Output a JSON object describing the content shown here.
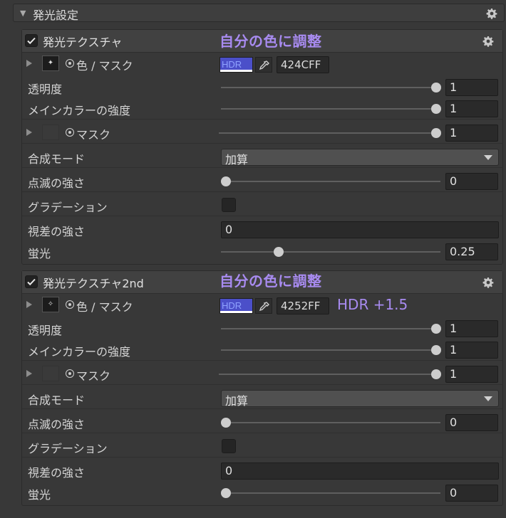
{
  "header": {
    "title": "発光設定"
  },
  "sections": [
    {
      "title": "発光テクスチャ",
      "note": "自分の色に調整",
      "color_label": "色 / マスク",
      "hdr_label": "HDR",
      "hex": "424CFF",
      "hdr_note": "",
      "opacity_label": "透明度",
      "opacity": "1",
      "main_strength_label": "メインカラーの強度",
      "main_strength": "1",
      "mask_label": "マスク",
      "mask": "1",
      "blend_label": "合成モード",
      "blend": "加算",
      "blink_label": "点滅の強さ",
      "blink": "0",
      "gradation_label": "グラデーション",
      "parallax_label": "視差の強さ",
      "parallax": "0",
      "fluorescence_label": "蛍光",
      "fluorescence": "0.25"
    },
    {
      "title": "発光テクスチャ2nd",
      "note": "自分の色に調整",
      "color_label": "色 / マスク",
      "hdr_label": "HDR",
      "hex": "4252FF",
      "hdr_note": "HDR +1.5",
      "opacity_label": "透明度",
      "opacity": "1",
      "main_strength_label": "メインカラーの強度",
      "main_strength": "1",
      "mask_label": "マスク",
      "mask": "1",
      "blend_label": "合成モード",
      "blend": "加算",
      "blink_label": "点滅の強さ",
      "blink": "0",
      "gradation_label": "グラデーション",
      "parallax_label": "視差の強さ",
      "parallax": "0",
      "fluorescence_label": "蛍光",
      "fluorescence": "0"
    }
  ],
  "colors": {
    "note": "#a88bf0",
    "swatch": "#4b4fc9"
  },
  "icons": [
    "gear-icon",
    "check-icon",
    "eyedropper-icon",
    "fold-triangle-icon",
    "chevron-down-icon"
  ]
}
